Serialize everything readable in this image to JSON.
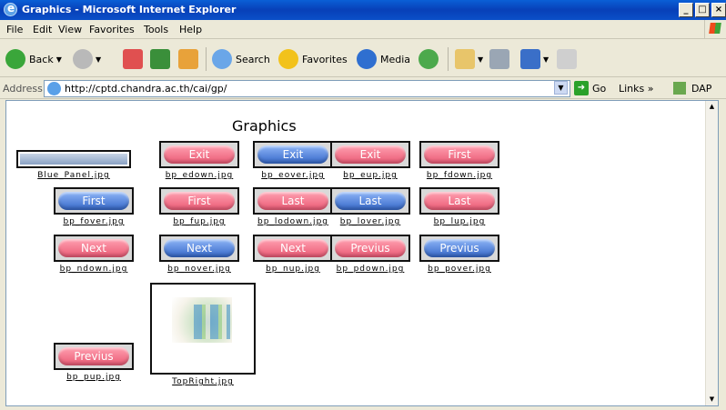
{
  "window": {
    "title": "Graphics - Microsoft Internet Explorer",
    "buttons": [
      "_",
      "□",
      "×"
    ]
  },
  "menu": [
    "File",
    "Edit",
    "View",
    "Favorites",
    "Tools",
    "Help"
  ],
  "toolbar": {
    "back": "Back",
    "search": "Search",
    "favorites": "Favorites",
    "media": "Media"
  },
  "address": {
    "label": "Address",
    "url": "http://cptd.chandra.ac.th/cai/gp/",
    "go": "Go",
    "links": "Links",
    "extra": "DAP"
  },
  "page": {
    "heading": "Graphics",
    "items": [
      {
        "caption": "Blue_Panel.jpg",
        "kind": "panel"
      },
      {
        "caption": "bp_edown.jpg",
        "label": "Exit",
        "color": "pink"
      },
      {
        "caption": "bp_eover.jpg",
        "label": "Exit",
        "color": "blue"
      },
      {
        "caption": "bp_eup.jpg",
        "label": "Exit",
        "color": "pink"
      },
      {
        "caption": "bp_fdown.jpg",
        "label": "First",
        "color": "pink"
      },
      {
        "caption": "bp_fover.jpg",
        "label": "First",
        "color": "blue"
      },
      {
        "caption": "bp_fup.jpg",
        "label": "First",
        "color": "pink"
      },
      {
        "caption": "bp_lodown.jpg",
        "label": "Last",
        "color": "pink"
      },
      {
        "caption": "bp_lover.jpg",
        "label": "Last",
        "color": "blue"
      },
      {
        "caption": "bp_lup.jpg",
        "label": "Last",
        "color": "pink"
      },
      {
        "caption": "bp_ndown.jpg",
        "label": "Next",
        "color": "pink"
      },
      {
        "caption": "bp_nover.jpg",
        "label": "Next",
        "color": "blue"
      },
      {
        "caption": "bp_nup.jpg",
        "label": "Next",
        "color": "pink"
      },
      {
        "caption": "bp_pdown.jpg",
        "label": "Previus",
        "color": "pink"
      },
      {
        "caption": "bp_pover.jpg",
        "label": "Previus",
        "color": "blue"
      },
      {
        "caption": "bp_pup.jpg",
        "label": "Previus",
        "color": "pink"
      },
      {
        "caption": "TopRight.jpg",
        "kind": "image"
      }
    ]
  },
  "colors": {
    "pink": "#ea5a75",
    "blue": "#3567c8",
    "titlebar": "#0a4fc8"
  }
}
